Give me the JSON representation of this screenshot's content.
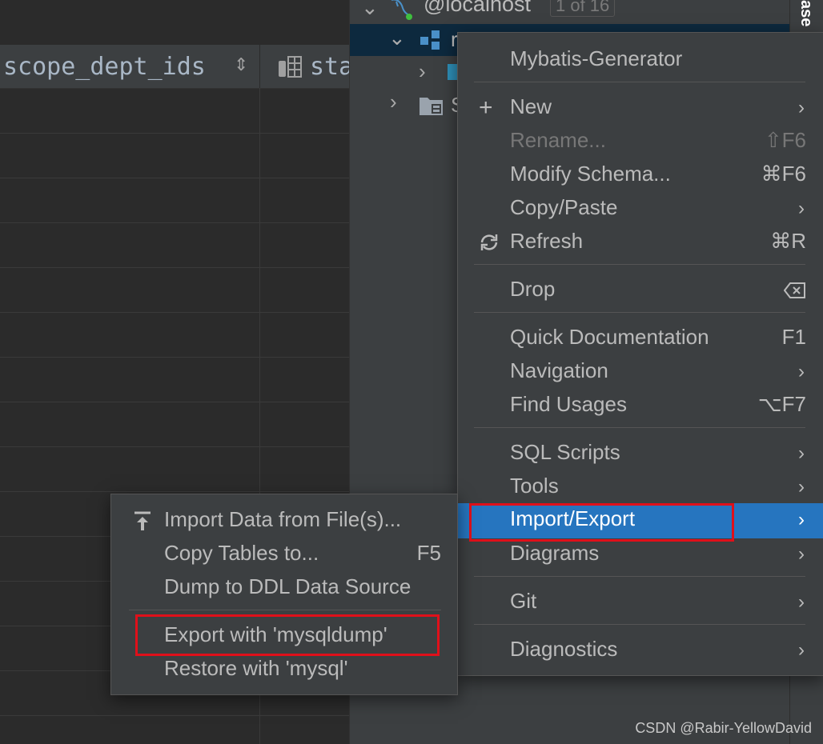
{
  "grid": {
    "columns": [
      {
        "name": "scope_dept_ids",
        "sort_icon": "sort-arrows-icon"
      },
      {
        "name": "sta",
        "icon": "table-column-icon"
      }
    ]
  },
  "tree": {
    "host": {
      "name": "@localhost",
      "counter": "1 of 16"
    }
  },
  "side_tab": {
    "label": "ase"
  },
  "context_menu": {
    "title": "Mybatis-Generator",
    "items": [
      {
        "label": "New",
        "icon": "plus-icon",
        "submenu": true
      },
      {
        "label": "Rename...",
        "shortcut": "⇧F6",
        "disabled": true
      },
      {
        "label": "Modify Schema...",
        "shortcut": "⌘F6"
      },
      {
        "label": "Copy/Paste",
        "submenu": true
      },
      {
        "label": "Refresh",
        "icon": "refresh-icon",
        "shortcut": "⌘R"
      },
      {
        "label": "Drop",
        "shortcut_icon": "delete-key-icon"
      },
      {
        "label": "Quick Documentation",
        "shortcut": "F1"
      },
      {
        "label": "Navigation",
        "submenu": true
      },
      {
        "label": "Find Usages",
        "shortcut": "⌥F7"
      },
      {
        "label": "SQL Scripts",
        "submenu": true
      },
      {
        "label": "Tools",
        "submenu": true
      },
      {
        "label": "Import/Export",
        "submenu": true,
        "active": true,
        "highlighted": true
      },
      {
        "label": "Diagrams",
        "submenu": true
      },
      {
        "label": "Git",
        "submenu": true
      },
      {
        "label": "Diagnostics",
        "submenu": true
      }
    ]
  },
  "submenu": {
    "items": [
      {
        "label": "Import Data from File(s)...",
        "icon": "import-icon"
      },
      {
        "label": "Copy Tables to...",
        "shortcut": "F5"
      },
      {
        "label": "Dump to DDL Data Source"
      },
      {
        "label": "Export with 'mysqldump'",
        "highlighted": true
      },
      {
        "label": "Restore with 'mysql'"
      }
    ]
  },
  "colors": {
    "menu_bg": "#3c3f41",
    "selection": "#2675bf",
    "highlight_box": "#e0101a",
    "editor_bg": "#2b2b2b"
  },
  "watermark": "CSDN @Rabir-YellowDavid"
}
